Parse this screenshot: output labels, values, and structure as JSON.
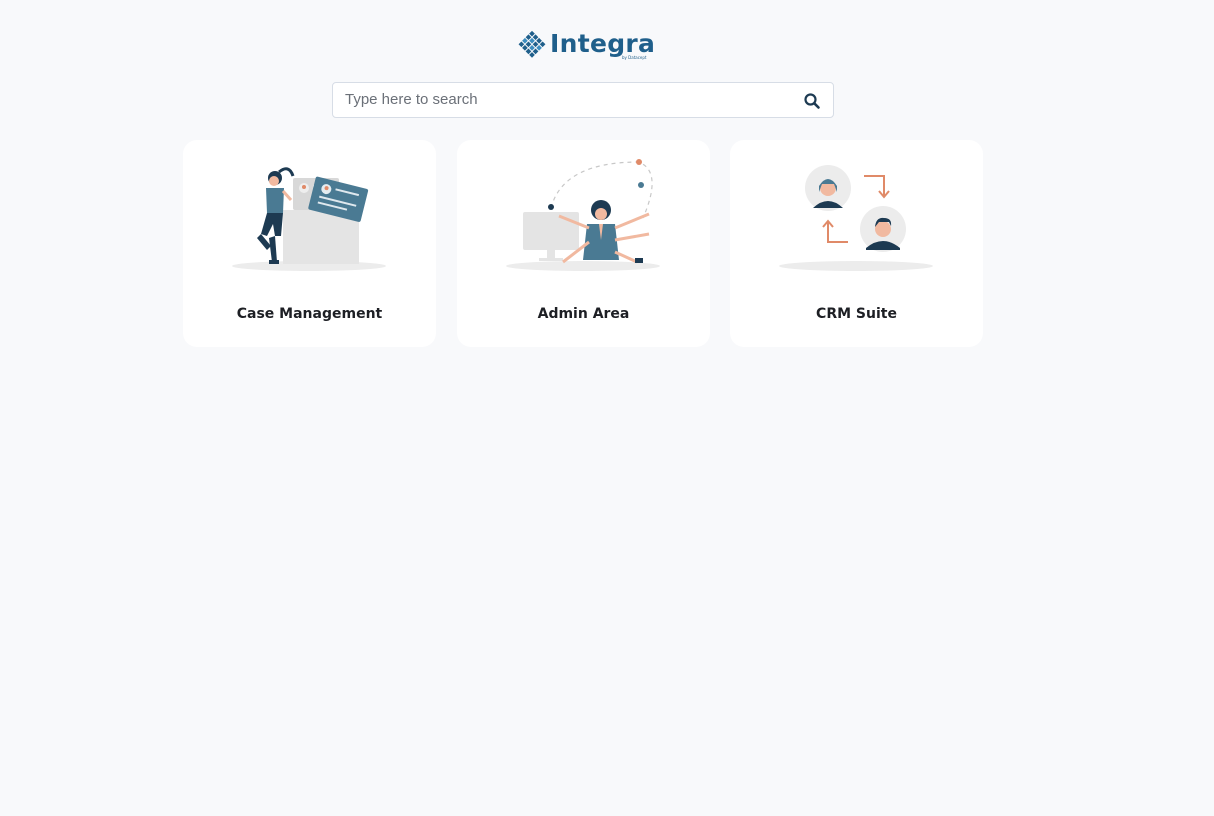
{
  "brand": {
    "name": "Integra",
    "byline": "by Datacept",
    "color": "#1f5f8b"
  },
  "search": {
    "placeholder": "Type here to search",
    "value": "",
    "icon": "search-icon"
  },
  "apps": [
    {
      "label": "Case Management",
      "illustration": "woman-with-files-illustration"
    },
    {
      "label": "Admin Area",
      "illustration": "multitasking-admin-illustration"
    },
    {
      "label": "CRM Suite",
      "illustration": "customer-exchange-illustration"
    }
  ],
  "colors": {
    "background": "#f8f9fb",
    "card": "#ffffff",
    "accent_blue": "#4a7a93",
    "accent_orange": "#e08a68",
    "dark_navy": "#1d3a52"
  }
}
